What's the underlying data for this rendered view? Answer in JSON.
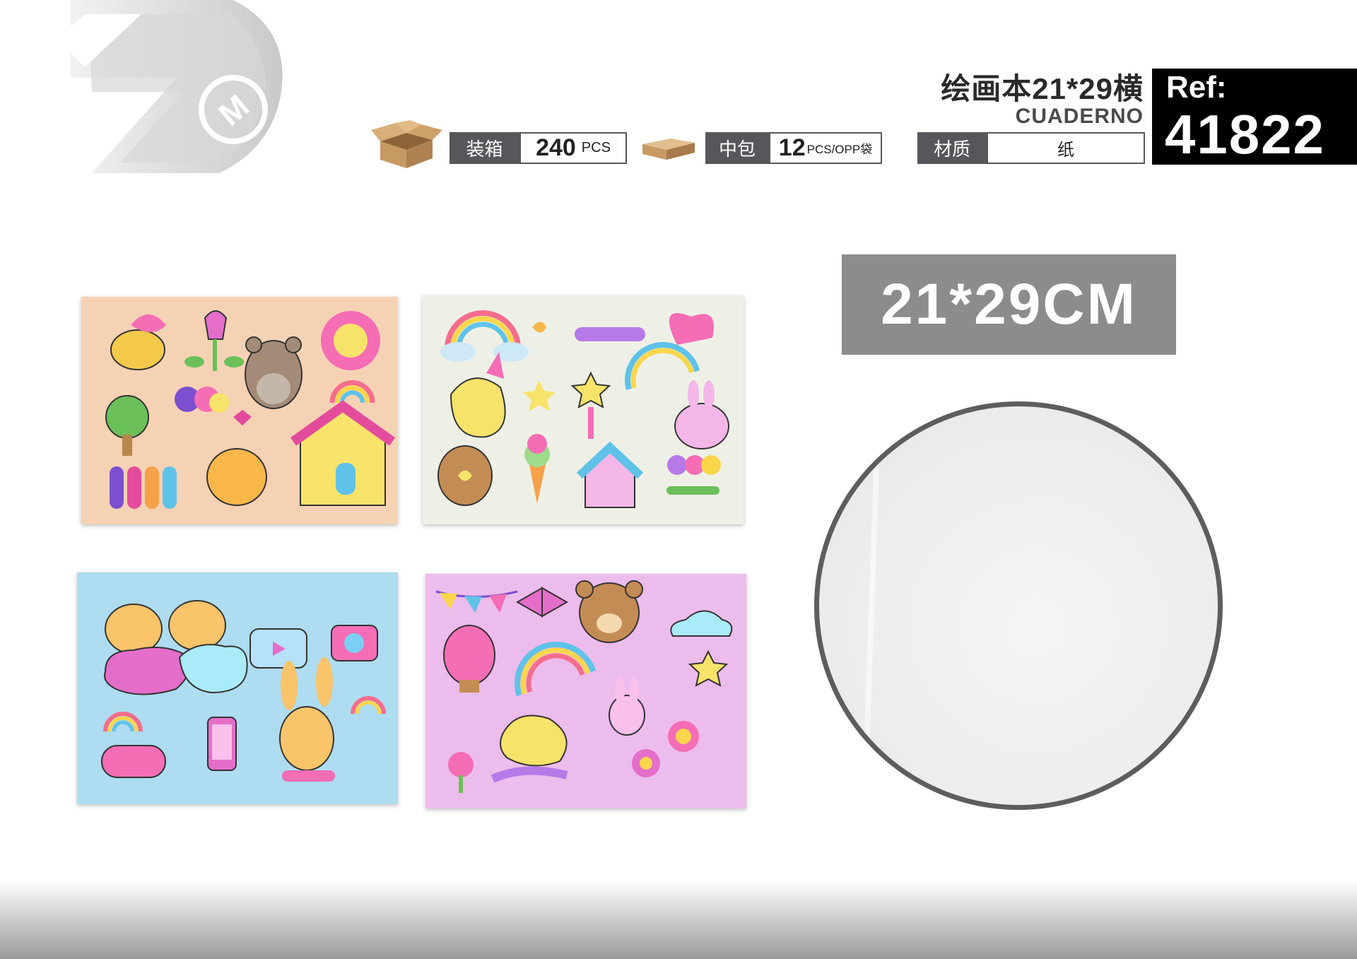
{
  "brand": {
    "logo_letter": "M"
  },
  "header": {
    "title_cn": "绘画本21*29横",
    "title_es": "CUADERNO",
    "ref_label": "Ref:",
    "ref_number": "41822"
  },
  "specs": {
    "carton_label": "装箱",
    "carton_qty": "240",
    "carton_unit": "PCS",
    "inner_label": "中包",
    "inner_qty": "12",
    "inner_unit": "PCS/OPP袋",
    "material_label": "材质",
    "material_value": "纸"
  },
  "size_label": "21*29CM",
  "colors": {
    "card1_bg": "#f6d2b4",
    "card2_bg": "#eef0e6",
    "card3_bg": "#aedcf0",
    "card4_bg": "#ecbcec",
    "spec_dark": "#56575b",
    "ref_bg": "#000000",
    "banner_bg": "#8c8c8c"
  },
  "icons": [
    "carton-box-icon",
    "tray-box-icon",
    "brand-logo-icon"
  ]
}
